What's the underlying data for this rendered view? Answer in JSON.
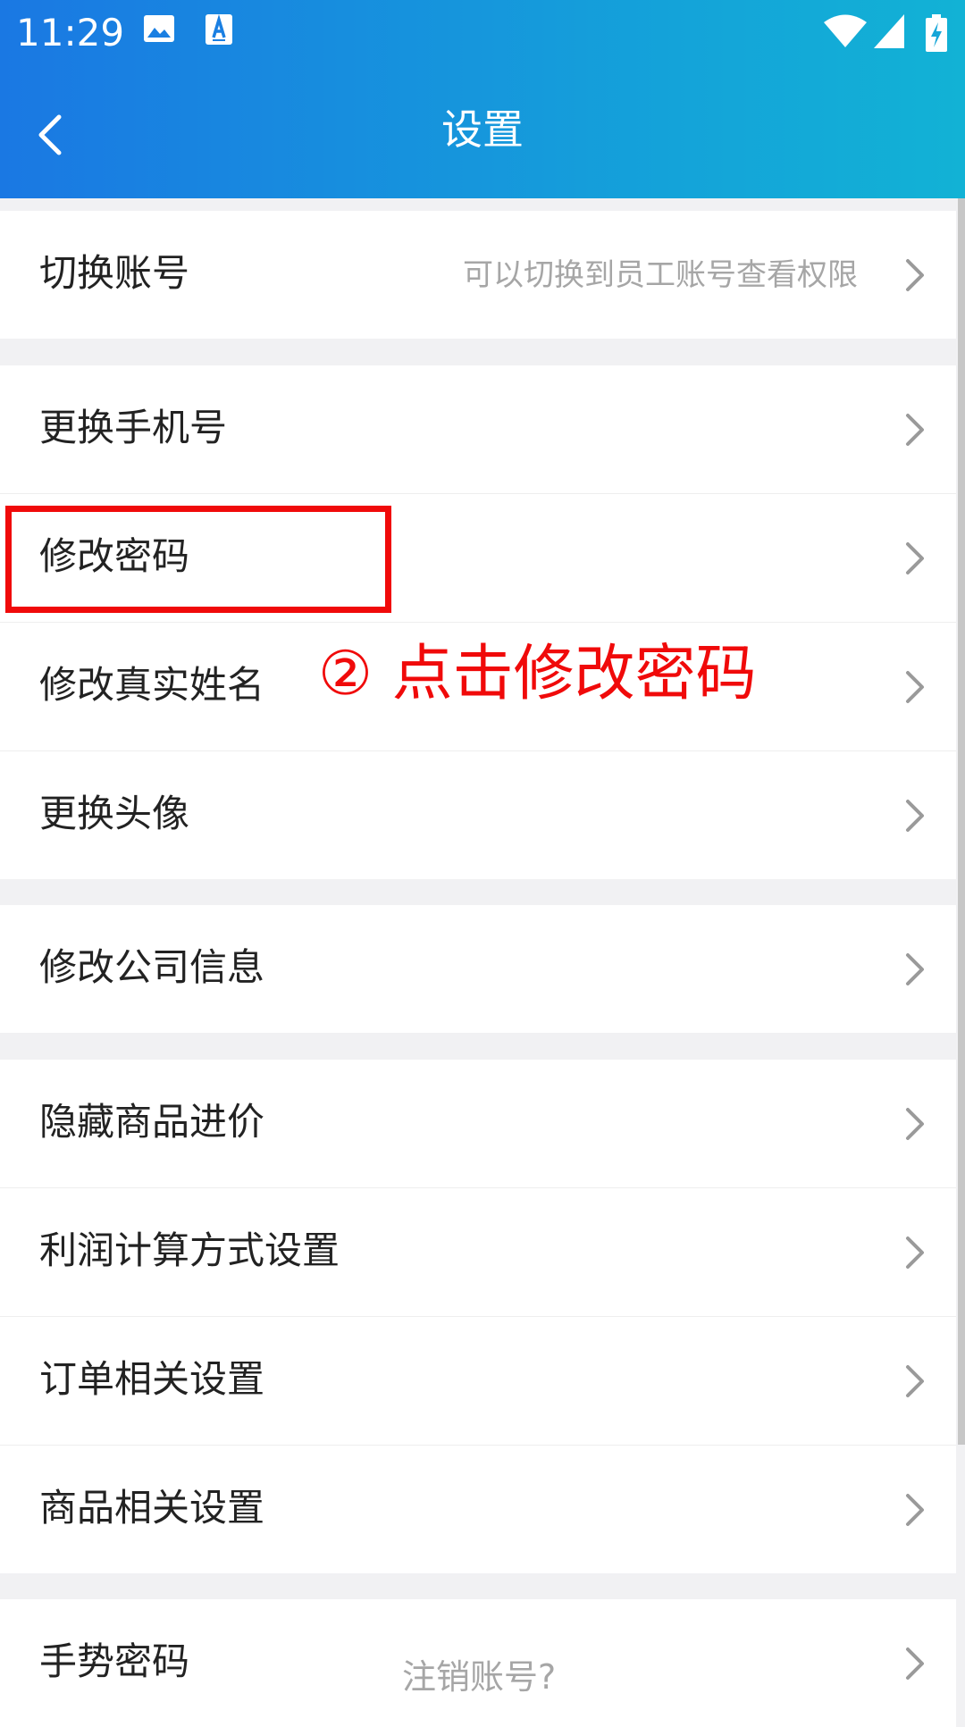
{
  "status_bar": {
    "time": "11:29",
    "icons": [
      "image-icon",
      "font-download-icon",
      "wifi-icon",
      "cell-signal-icon",
      "battery-charging-icon"
    ]
  },
  "nav": {
    "title": "设置",
    "back_icon": "chevron-left-icon"
  },
  "groups": [
    [
      {
        "label": "切换账号",
        "hint": "可以切换到员工账号查看权限"
      }
    ],
    [
      {
        "label": "更换手机号"
      },
      {
        "label": "修改密码"
      },
      {
        "label": "修改真实姓名"
      },
      {
        "label": "更换头像"
      }
    ],
    [
      {
        "label": "修改公司信息"
      }
    ],
    [
      {
        "label": "隐藏商品进价"
      },
      {
        "label": "利润计算方式设置"
      },
      {
        "label": "订单相关设置"
      },
      {
        "label": "商品相关设置"
      }
    ],
    [
      {
        "label": "手势密码"
      }
    ]
  ],
  "annotation": {
    "text": "② 点击修改密码",
    "color": "#f00a0a"
  },
  "cancel_account_link": "注销账号?",
  "colors": {
    "header_start": "#1a78e3",
    "header_end": "#12b2d5",
    "background": "#f1f1f3",
    "chevron": "#9a9a9a"
  }
}
